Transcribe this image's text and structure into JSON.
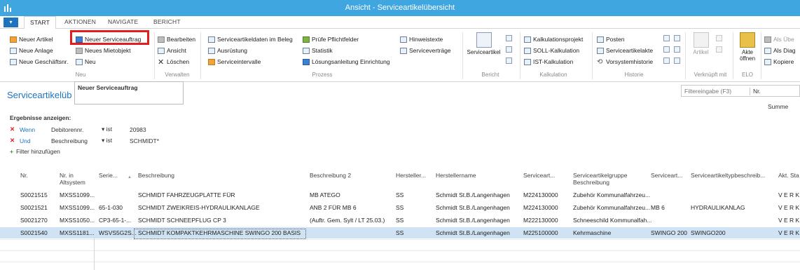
{
  "window": {
    "title": "Ansicht - Serviceartikelübersicht",
    "logo_icon": "nav-logo-icon"
  },
  "tabs": {
    "app_menu": "▾",
    "start": "START",
    "aktionen": "AKTIONEN",
    "navigate": "NAVIGATE",
    "bericht": "BERICHT"
  },
  "ribbon": {
    "neu": {
      "neuer_artikel": "Neuer Artikel",
      "neue_anlage": "Neue Anlage",
      "neue_geschaeftsnr": "Neue Geschäftsnr.",
      "neuer_serviceauftrag": "Neuer Serviceauftrag",
      "neues_mietobjekt": "Neues Mietobjekt",
      "neu": "Neu",
      "group": "Neu"
    },
    "verwalten": {
      "bearbeiten": "Bearbeiten",
      "ansicht": "Ansicht",
      "loeschen": "Löschen",
      "group": "Verwalten"
    },
    "prozess": {
      "serviceartikeldaten": "Serviceartikeldaten im Beleg",
      "ausruestung": "Ausrüstung",
      "serviceintervalle": "Serviceintervalle",
      "pruefe": "Prüfe Pflichtfelder",
      "statistik": "Statistik",
      "loesungsanleitung": "Lösungsanleitung Einrichtung",
      "hinweistexte": "Hinweistexte",
      "servicevertraege": "Serviceverträge",
      "group": "Prozess"
    },
    "bericht": {
      "serviceartikel": "Serviceartikel",
      "group": "Bericht"
    },
    "kalkulation": {
      "kalkulationsprojekt": "Kalkulationsprojekt",
      "soll": "SOLL-Kalkulation",
      "ist": "IST-Kalkulation",
      "group": "Kalkulation"
    },
    "historie": {
      "posten": "Posten",
      "serviceartikelakte": "Serviceartikelakte",
      "vorsystemhistorie": "Vorsystemhistorie",
      "group": "Historie"
    },
    "verknuepft": {
      "artikel": "Artikel",
      "group": "Verknüpft mit"
    },
    "elo": {
      "akte_oeffnen": "Akte öffnen",
      "group": "ELO"
    },
    "extra": {
      "als_ueber": "Als Übe",
      "als_diag": "Als Diag",
      "kopiere": "Kopiere"
    }
  },
  "tooltip": {
    "text": "Neuer Serviceauftrag"
  },
  "page": {
    "title": "Serviceartikelüb",
    "filter_placeholder": "Filtereingabe (F3)",
    "filter_field": "Nr.",
    "summe": "Summe"
  },
  "filters": {
    "heading": "Ergebnisse anzeigen:",
    "rows": [
      {
        "x": "✕",
        "kw": "Wenn",
        "field": "Debitorennr.",
        "op": "▾ ist",
        "value": "20983"
      },
      {
        "x": "✕",
        "kw": "Und",
        "field": "Beschreibung",
        "op": "▾ ist",
        "value": "SCHMIDT*"
      }
    ],
    "add": "Filter hinzufügen",
    "add_plus": "+"
  },
  "table": {
    "headers": {
      "nr": "Nr.",
      "nr_alt": "Nr. in Altsystem",
      "serie": "Serie...",
      "sort": "▲",
      "beschreibung": "Beschreibung",
      "beschreibung2": "Beschreibung 2",
      "hersteller": "Hersteller...",
      "herstellername": "Herstellername",
      "serviceart": "Serviceart...",
      "gruppe": "Serviceartikelgruppe Beschreibung",
      "serviceart2": "Serviceart...",
      "typ": "Serviceartikeltypbeschreib...",
      "akt": "Akt. Sta"
    },
    "rows": [
      {
        "nr": "S0021515",
        "nr_alt": "MXSS1099...",
        "serie": "",
        "beschreibung": "SCHMIDT FAHRZEUGPLATTE FÜR",
        "beschreibung2": "MB ATEGO",
        "hersteller": "SS",
        "herstellername": "Schmidt St.B./Langenhagen",
        "serviceart": "M224130000",
        "gruppe": "Zubehör Kommunalfahrzeu...",
        "serviceart2": "",
        "typ": "",
        "akt": "V E R K A"
      },
      {
        "nr": "S0021521",
        "nr_alt": "MXSS1099...",
        "serie": "65-1-030",
        "beschreibung": "SCHMIDT ZWEIKREIS-HYDRAULIKANLAGE",
        "beschreibung2": "ANB 2 FÜR MB 6",
        "hersteller": "SS",
        "herstellername": "Schmidt St.B./Langenhagen",
        "serviceart": "M224130000",
        "gruppe": "Zubehör Kommunalfahrzeu...",
        "serviceart2": "MB 6",
        "typ": "HYDRAULIKANLAG",
        "akt": "V E R K A"
      },
      {
        "nr": "S0021270",
        "nr_alt": "MXSS1050...",
        "serie": "CP3-65-1-...",
        "beschreibung": "SCHMIDT SCHNEEPFLUG CP 3",
        "beschreibung2": "(Auftr. Gem. Sylt / LT 25.03.)",
        "hersteller": "SS",
        "herstellername": "Schmidt St.B./Langenhagen",
        "serviceart": "M222130000",
        "gruppe": "Schneeschild Kommunalfah...",
        "serviceart2": "",
        "typ": "",
        "akt": "V E R K A"
      },
      {
        "nr": "S0021540",
        "nr_alt": "MXSS1181...",
        "serie": "WSVS5G2S...",
        "beschreibung": "SCHMIDT KOMPAKTKEHRMASCHINE SWINGO 200 BASIS",
        "beschreibung2": "",
        "hersteller": "SS",
        "herstellername": "Schmidt St.B./Langenhagen",
        "serviceart": "M225100000",
        "gruppe": "Kehrmaschine",
        "serviceart2": "SWINGO 200",
        "typ": "SWINGO200",
        "akt": "V E R K A"
      }
    ]
  }
}
